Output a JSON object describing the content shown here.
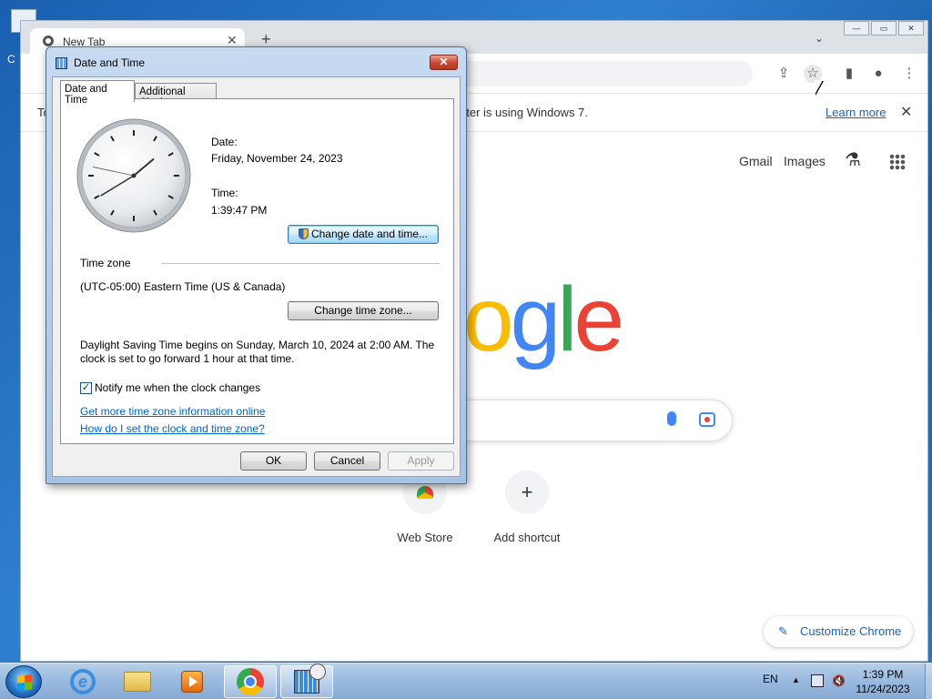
{
  "desktop": {
    "icon_label": "C"
  },
  "chrome": {
    "tab_title": "New Tab",
    "tab_close": "✕",
    "new_tab": "+",
    "tab_menu": "⌄",
    "window_controls": {
      "minimize": "—",
      "maximize": "▭",
      "close": "✕"
    },
    "infobar": {
      "text_prefix": "To",
      "text": "uter is using Windows 7.",
      "link": "Learn more",
      "close": "✕"
    },
    "top_links": {
      "gmail": "Gmail",
      "images": "Images"
    },
    "logo_letters": [
      "o",
      "g",
      "l",
      "e"
    ],
    "shortcuts": [
      {
        "label": "Web Store"
      },
      {
        "label": "Add shortcut",
        "glyph": "+"
      }
    ],
    "customize_label": "Customize Chrome",
    "customize_icon": "✎"
  },
  "dialog": {
    "title": "Date and Time",
    "close": "✕",
    "tabs": [
      "Date and Time",
      "Additional Clocks"
    ],
    "date_label": "Date:",
    "date_value": "Friday, November 24, 2023",
    "time_label": "Time:",
    "time_value": "1:39:47 PM",
    "change_datetime_button": "Change date and time...",
    "timezone_heading": "Time zone",
    "timezone_value": "(UTC-05:00) Eastern Time (US & Canada)",
    "change_timezone_button": "Change time zone...",
    "dst_line1": "Daylight Saving Time begins on Sunday, March 10, 2024 at 2:00 AM. The",
    "dst_line2": "clock is set to go forward 1 hour at that time.",
    "notify_checked": true,
    "notify_check_glyph": "✓",
    "notify_label": "Notify me when the clock changes",
    "link_more_info": "Get more time zone information online",
    "link_how_to": "How do I set the clock and time zone?",
    "ok": "OK",
    "cancel": "Cancel",
    "apply": "Apply",
    "clock": {
      "hours": 1,
      "minutes": 39,
      "seconds": 47
    }
  },
  "taskbar": {
    "language": "EN",
    "time": "1:39 PM",
    "date": "11/24/2023"
  },
  "colors": {
    "google_blue": "#4285f4",
    "google_red": "#ea4335",
    "google_yellow": "#fbbc05",
    "google_green": "#34a853",
    "link": "#0066cc"
  }
}
